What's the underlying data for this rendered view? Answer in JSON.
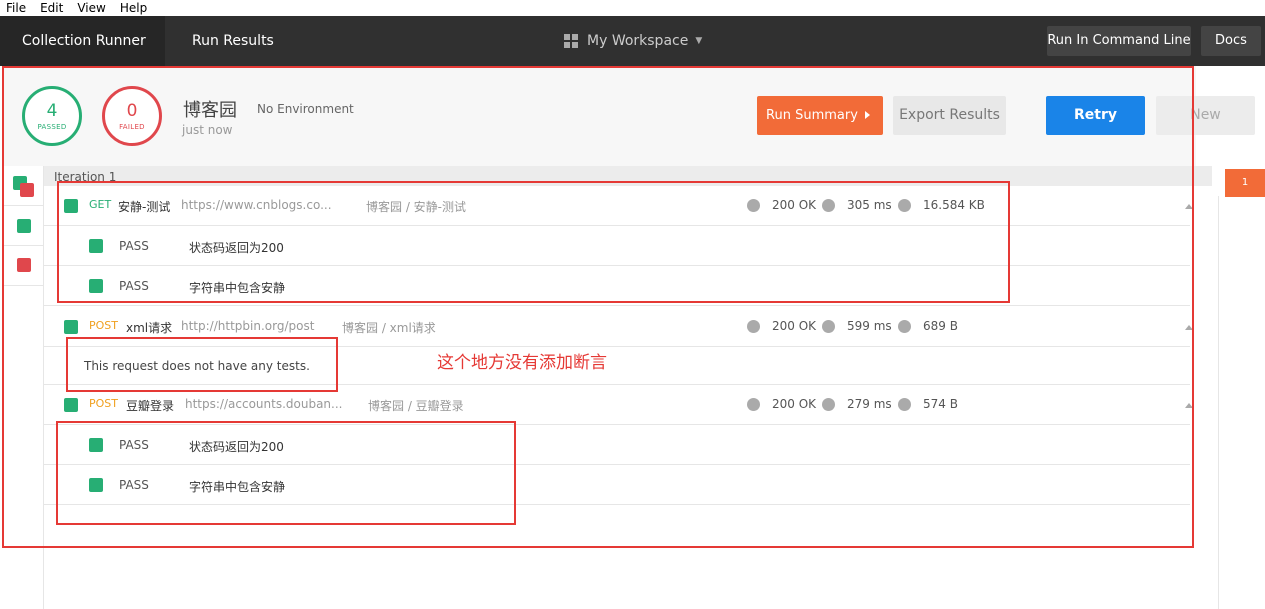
{
  "menu": [
    "File",
    "Edit",
    "View",
    "Help"
  ],
  "breadcrumbs": {
    "runner": "Collection Runner",
    "results": "Run Results"
  },
  "workspace": {
    "label": "My Workspace"
  },
  "top_buttons": {
    "cmd": "Run In Command Line",
    "docs": "Docs"
  },
  "summary": {
    "passed_count": "4",
    "passed_label": "PASSED",
    "failed_count": "0",
    "failed_label": "FAILED",
    "collection_name": "博客园",
    "environment": "No Environment",
    "time_ago": "just now",
    "run_summary_label": "Run Summary",
    "export_label": "Export Results",
    "retry_label": "Retry",
    "new_label": "New"
  },
  "iteration_label": "Iteration 1",
  "requests": [
    {
      "method": "GET",
      "name": "安静-测试",
      "url": "https://www.cnblogs.co...",
      "path": "博客园 / 安静-测试",
      "status": "200 OK",
      "time": "305 ms",
      "size": "16.584 KB",
      "tests": [
        {
          "result": "PASS",
          "desc": "状态码返回为200"
        },
        {
          "result": "PASS",
          "desc": "字符串中包含安静"
        }
      ]
    },
    {
      "method": "POST",
      "name": "xml请求",
      "url": "http://httpbin.org/post",
      "path": "博客园 / xml请求",
      "status": "200 OK",
      "time": "599 ms",
      "size": "689 B",
      "no_tests": "This request does not have any tests."
    },
    {
      "method": "POST",
      "name": "豆瓣登录",
      "url": "https://accounts.douban...",
      "path": "博客园 / 豆瓣登录",
      "status": "200 OK",
      "time": "279 ms",
      "size": "574 B",
      "tests": [
        {
          "result": "PASS",
          "desc": "状态码返回为200"
        },
        {
          "result": "PASS",
          "desc": "字符串中包含安静"
        }
      ]
    }
  ],
  "annotation": "这个地方没有添加断言",
  "right_badge": "1",
  "colors": {
    "pass_green": "#27ae74",
    "fail_red": "#e0474c",
    "accent_orange": "#f26b38",
    "retry_blue": "#1a84e8",
    "get_green": "#27ae74",
    "post_orange": "#f0a020",
    "annotation_red": "#e53935"
  }
}
